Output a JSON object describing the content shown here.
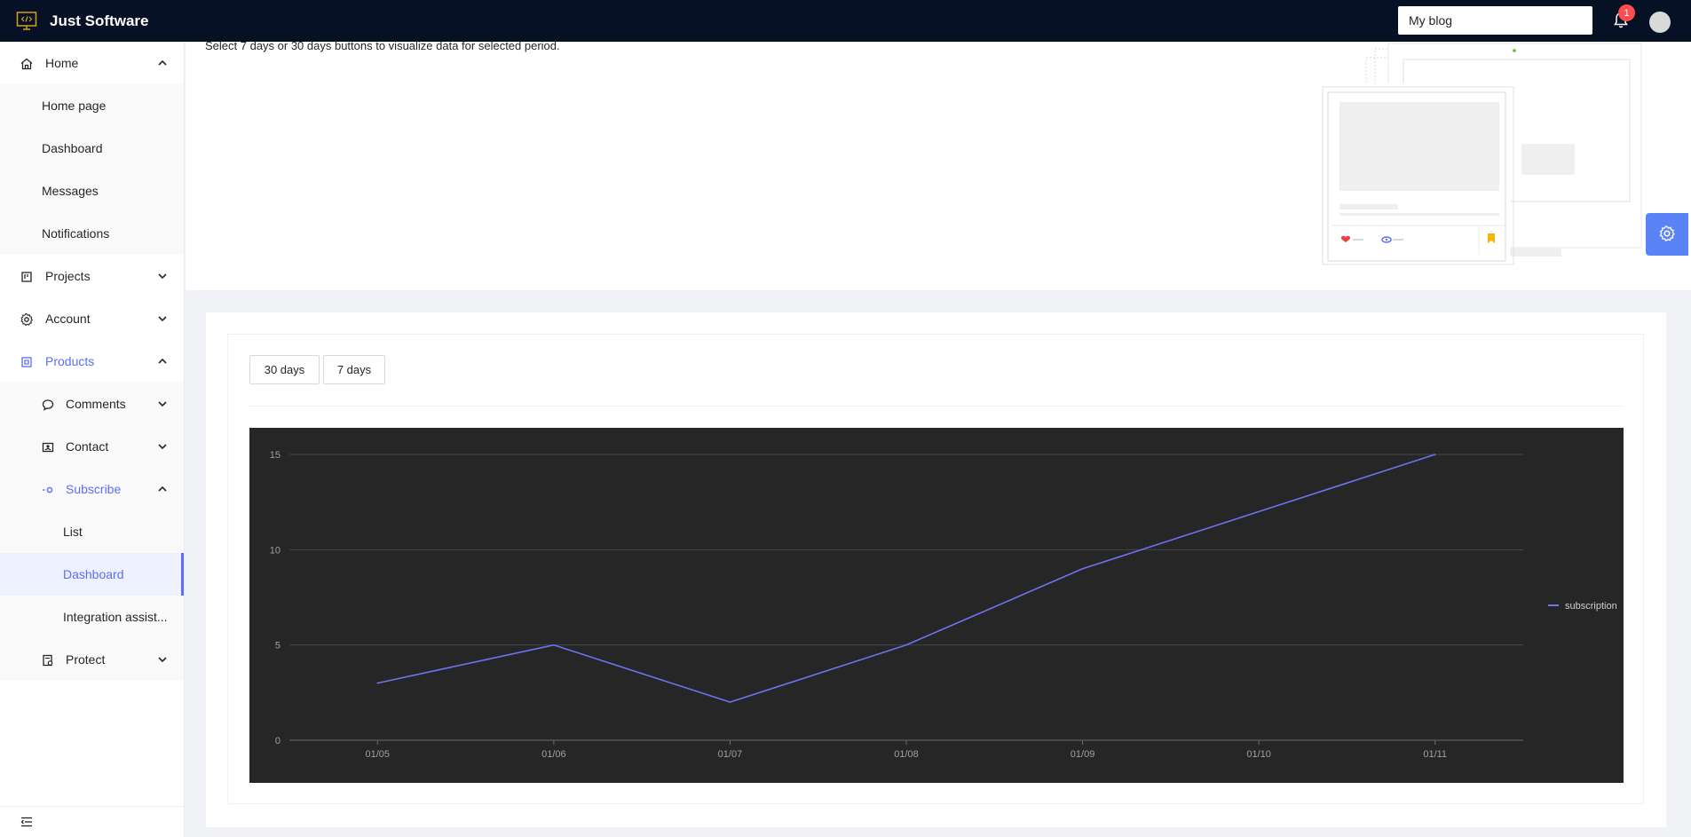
{
  "app": {
    "title": "Just Software",
    "blog_select": "My blog",
    "notification_count": "1"
  },
  "sidebar": {
    "home": "Home",
    "home_children": [
      "Home page",
      "Dashboard",
      "Messages",
      "Notifications"
    ],
    "projects": "Projects",
    "account": "Account",
    "products": "Products",
    "comments": "Comments",
    "contact": "Contact",
    "subscribe": "Subscribe",
    "subscribe_children": [
      "List",
      "Dashboard",
      "Integration assist..."
    ],
    "protect": "Protect",
    "selected_item": "Dashboard"
  },
  "header": {
    "description": "Select 7 days or 30 days buttons to visualize data for selected period."
  },
  "controls": {
    "btn_30": "30 days",
    "btn_7": "7 days"
  },
  "colors": {
    "accent": "#5b6ef5",
    "topbar": "#061126",
    "chart_bg": "#262626",
    "line": "#6f73f0"
  },
  "chart_data": {
    "type": "line",
    "x": [
      "01/05",
      "01/06",
      "01/07",
      "01/08",
      "01/09",
      "01/10",
      "01/11"
    ],
    "series": [
      {
        "name": "subscription",
        "values": [
          3,
          5,
          2,
          5,
          9,
          12,
          15
        ]
      }
    ],
    "yticks": [
      0,
      5,
      10,
      15
    ],
    "ylim": [
      0,
      15
    ],
    "grid": true,
    "legend": "right"
  }
}
